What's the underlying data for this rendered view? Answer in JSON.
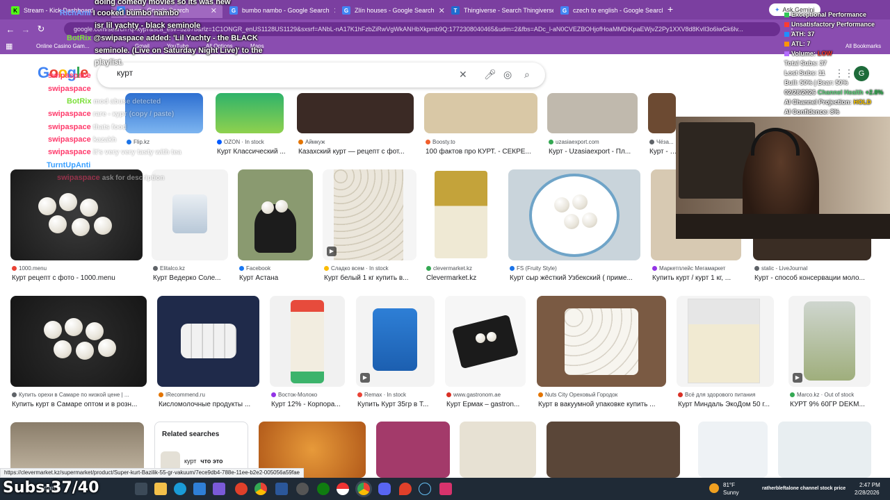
{
  "browser": {
    "tabs": [
      {
        "title": "Stream - Kick Dashboard",
        "favicon_color": "#53fc18",
        "favicon_letter": "K"
      },
      {
        "title": "курт - Google Search",
        "favicon_color": "#4285f4",
        "favicon_letter": "G"
      },
      {
        "title": "bumbo nambo - Google Search",
        "favicon_color": "#4285f4",
        "favicon_letter": "G"
      },
      {
        "title": "Zlín houses - Google Search",
        "favicon_color": "#4285f4",
        "favicon_letter": "G"
      },
      {
        "title": "Thingiverse - Search Thingiverse",
        "favicon_color": "#1f6dd0",
        "favicon_letter": "T"
      },
      {
        "title": "czech to english - Google Search",
        "favicon_color": "#4285f4",
        "favicon_letter": "G"
      }
    ],
    "gemini_label": "Ask Gemini",
    "url": "google.com/search?q=курт&sca_esv=5287b&rlz=1C1ONGR_enUS1128US1129&sxsrf=ANbL-nA17K1hFzbZiRwVgWkANHbXkpmb9Q:1772308040465&udm=2&fbs=ADc_l-aN0CVEZBOHjofHoaMMDiKpaEWjvZ2Py1XXV8d8KvlI3o6iwGk6lv...",
    "bookmarks": [
      "Online Casino Gam...",
      "Gmail",
      "YouTube",
      "All Options",
      "Maps"
    ],
    "all_bookmarks": "All Bookmarks"
  },
  "google": {
    "logo": "Google",
    "query": "курт"
  },
  "results": {
    "row0": [
      {
        "source": "Flip.kz",
        "title": "",
        "dot": "#1a73e8"
      },
      {
        "source": "OZON · In stock",
        "title": "Курт Классический ...",
        "dot": "#005bff"
      },
      {
        "source": "Аймкуж",
        "title": "Казахский курт — рецепт с фот...",
        "dot": "#e37400"
      },
      {
        "source": "Boosty.to",
        "title": "100 фактов про КУРТ. - СЕКРЕ...",
        "dot": "#f15f2c"
      },
      {
        "source": "uzasiaexport.com",
        "title": "Курт - Uzasiaexport - Пл...",
        "dot": "#34a853"
      },
      {
        "source": "Чёза...",
        "title": "Курт - ч...",
        "dot": "#5f6368"
      }
    ],
    "row1": [
      {
        "source": "1000.menu",
        "title": "Курт рецепт с фото - 1000.menu",
        "dot": "#ea4335"
      },
      {
        "source": "Elitalco.kz",
        "title": "Курт Ведерко Соле...",
        "dot": "#5f6368"
      },
      {
        "source": "Facebook",
        "title": "Курт Астана",
        "dot": "#1877f2"
      },
      {
        "source": "Сладко всем · In stock",
        "title": "Курт белый 1 кг купить в...",
        "dot": "#fbbc04"
      },
      {
        "source": "clevermarket.kz",
        "title": "Clevermarket.kz",
        "dot": "#34a853"
      },
      {
        "source": "FS (Fruity Style)",
        "title": "Курт сыр жёсткий Узбекский ( приме...",
        "dot": "#1a73e8"
      },
      {
        "source": "Маркетплейс Мегамаркет",
        "title": "Купить курт / курт 1 кг, ...",
        "dot": "#9334e6"
      },
      {
        "source": "stalic - LiveJournal",
        "title": "Курт - способ консервации моло...",
        "dot": "#5f6368"
      }
    ],
    "row2": [
      {
        "source": "Купить орехи в Самаре по низкой цене | ...",
        "title": "Купить курт в Самаре оптом и в розн...",
        "dot": "#5f6368"
      },
      {
        "source": "IRecommend.ru",
        "title": "Кисломолочные продукты ...",
        "dot": "#e37400"
      },
      {
        "source": "Восток-Молоко",
        "title": "Курт 12% - Корпора...",
        "dot": "#9334e6"
      },
      {
        "source": "Remax · In stock",
        "title": "Купить Курт 35гр в Т...",
        "dot": "#ea4335"
      },
      {
        "source": "www.gastronom.ae",
        "title": "Курт Ермак – gastron...",
        "dot": "#d93025"
      },
      {
        "source": "Nuts City Ореховый Городок",
        "title": "Курт в вакуумной упаковке купить ...",
        "dot": "#e37400"
      },
      {
        "source": "Всё для здорового питания",
        "title": "Курт Миндаль ЭкоДом 50 г...",
        "dot": "#d93025"
      },
      {
        "source": "Marco.kz · Out of stock",
        "title": "КУРТ 9% 60ГР DEKM...",
        "dot": "#34a853"
      }
    ]
  },
  "related": {
    "title": "Related searches",
    "item_query": "курт",
    "item_suffix": "что это"
  },
  "status_url": "https://clevermarket.kz/supermarket/product/Super-kurt-Bazilik-55-gr-vakuum/7ece9db4-788e-11ee-b2e2-005056a59fae",
  "chat": [
    {
      "name": "",
      "text": "doing comedy movies so its was new",
      "color": "#ffffff"
    },
    {
      "name": "RichAmi",
      "text": "I cooked bumbo nambo",
      "color": "#6aa3ff"
    },
    {
      "name": "",
      "text": "isr lil yachty - black seminole",
      "color": "#ffffff"
    },
    {
      "name": "BotRix",
      "text": "@swipaspace added: 'Lil Yachty - the BLACK",
      "color": "#7cdf3a"
    },
    {
      "name": "",
      "text": "seminole. (Live on Saturday Night Live)' to the",
      "color": "#ffffff"
    },
    {
      "name": "",
      "text": "playlist.",
      "color": "#ffffff"
    },
    {
      "name": "swipaspace",
      "text": "",
      "color": "#ff3a6b"
    },
    {
      "name": "swipaspace",
      "text": "",
      "color": "#ff3a6b"
    },
    {
      "name": "BotRix",
      "text": "mod abuse detected",
      "color": "#7cdf3a"
    },
    {
      "name": "swipaspace",
      "text": "rare - курт (copy / paste)",
      "color": "#ff3a6b"
    },
    {
      "name": "swipaspace",
      "text": "thats food",
      "color": "#ff3a6b"
    },
    {
      "name": "swipaspace",
      "text": "kazakh",
      "color": "#ff3a6b"
    },
    {
      "name": "swipaspace",
      "text": "it's very very tasty with tea",
      "color": "#ff3a6b"
    },
    {
      "name": "TurntUpAnti",
      "text": "",
      "color": "#3aa0ff"
    },
    {
      "name": "swipaspace",
      "text": "ask for description",
      "color": "#ff3a6b"
    }
  ],
  "stats": {
    "lines": [
      {
        "label": "Exceptional Performance",
        "color": "#34c759"
      },
      {
        "label": "Unsatisfactory Performance",
        "color": "#ff3b30"
      },
      {
        "label": "ATH: 37",
        "color": "#1e90ff"
      },
      {
        "label": "ATL: 7",
        "color": "#ff9500"
      }
    ],
    "volume_label": "Volume:",
    "volume_value": "LOW",
    "total_subs": "Total Subs: 37",
    "lost_subs": "Lost Subs: 11",
    "bull_bear": "Bull: 50% | Bear: 50%",
    "date": "02/28/2026",
    "channel_health_label": "Channel Health",
    "channel_health_value": "+2.8%",
    "projection_label": "AI Channel Projection:",
    "projection_value": "HOLD",
    "confidence": "AI Confidence: 8%"
  },
  "taskbar": {
    "subs_overlay": "Subs:37/40",
    "search_label": "Search",
    "weather_temp": "81°F",
    "weather_cond": "Sunny",
    "tray_text": "ratherbleftalone channel stock price",
    "time": "2:47 PM",
    "date": "2/28/2026"
  },
  "colors": {
    "browser_chrome": "#7b3fa0",
    "accent_green": "#34a853",
    "volume_low": "#ff3b30",
    "projection_hold": "#ffcc00"
  }
}
